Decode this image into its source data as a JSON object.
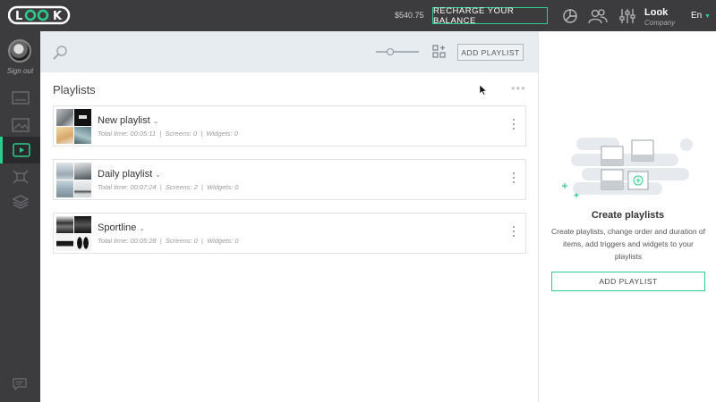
{
  "header": {
    "logo": "LOOK",
    "balance": "$540.75",
    "recharge_label": "RECHARGE YOUR BALANCE",
    "icons": [
      "pie-chart-icon",
      "users-icon",
      "sliders-icon"
    ],
    "user_name": "Look",
    "user_company": "Company",
    "language": "En"
  },
  "sidebar": {
    "sign_out": "Sign out",
    "items": [
      {
        "icon": "screen-icon",
        "active": false
      },
      {
        "icon": "image-icon",
        "active": false
      },
      {
        "icon": "playlist-icon",
        "active": true
      },
      {
        "icon": "widgets-icon",
        "active": false
      },
      {
        "icon": "layers-icon",
        "active": false
      }
    ],
    "chat_icon": "chat-icon"
  },
  "toolbar": {
    "search_icon": "search-icon",
    "add_playlist_label": "ADD PLAYLIST"
  },
  "main": {
    "title": "Playlists",
    "playlists": [
      {
        "name": "New playlist",
        "total_time": "Total time: 00:05:11",
        "screens": "Screens: 0",
        "widgets": "Widgets: 0"
      },
      {
        "name": "Daily playlist",
        "total_time": "Total time: 00:07:24",
        "screens": "Screens: 2",
        "widgets": "Widgets: 0"
      },
      {
        "name": "Sportline",
        "total_time": "Total time: 00:05:28",
        "screens": "Screens: 0",
        "widgets": "Widgets: 0"
      }
    ]
  },
  "right_panel": {
    "title": "Create playlists",
    "description": "Create playlists, change order and duration of items, add triggers and widgets to your playlists",
    "button_label": "ADD PLAYLIST"
  },
  "colors": {
    "accent": "#2dcc8f",
    "topbar": "#3c3c3f"
  }
}
